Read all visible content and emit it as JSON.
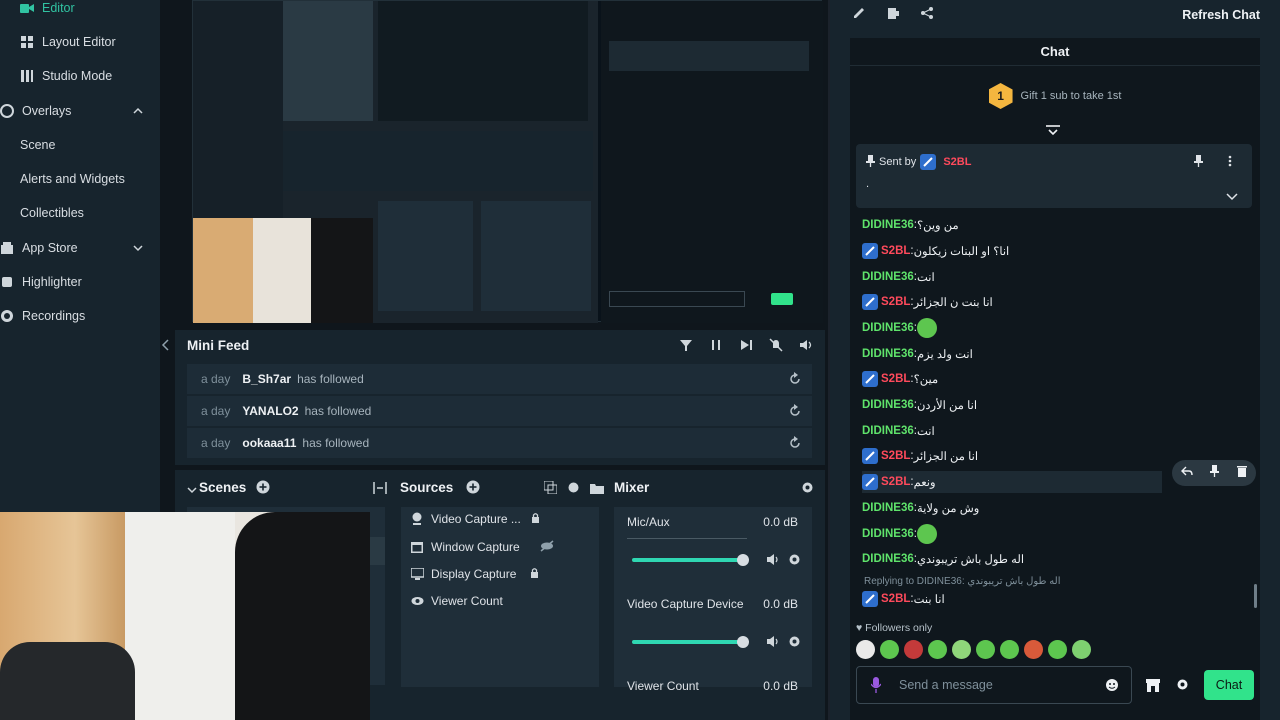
{
  "nav": {
    "items": [
      {
        "label": "Editor",
        "active": true
      },
      {
        "label": "Layout Editor"
      },
      {
        "label": "Studio Mode"
      },
      {
        "label": "Overlays"
      },
      {
        "label": "Scene"
      },
      {
        "label": "Alerts and Widgets"
      },
      {
        "label": "Collectibles"
      },
      {
        "label": "App Store"
      },
      {
        "label": "Highlighter"
      },
      {
        "label": "Recordings"
      }
    ]
  },
  "mini_feed": {
    "title": "Mini Feed",
    "rows": [
      {
        "ago": "a day",
        "name": "B_Sh7ar",
        "action": "has followed"
      },
      {
        "ago": "a day",
        "name": "YANALO2",
        "action": "has followed"
      },
      {
        "ago": "a day",
        "name": "ookaaa11",
        "action": "has followed"
      }
    ]
  },
  "dock": {
    "scenes_title": "Scenes",
    "sources_title": "Sources",
    "mixer_title": "Mixer",
    "sources": [
      "Video Capture ...",
      "Window Capture",
      "Display Capture",
      "Viewer Count"
    ],
    "mixer": [
      {
        "name": "Mic/Aux",
        "db": "0.0 dB"
      },
      {
        "name": "Video Capture Device",
        "db": "0.0 dB"
      },
      {
        "name": "Viewer Count",
        "db": "0.0 dB"
      }
    ]
  },
  "chat": {
    "refresh_label": "Refresh Chat",
    "title": "Chat",
    "gift_text": "Gift 1 sub to take 1st",
    "gift_badge": "1",
    "pinned": {
      "sent_by": "Sent by",
      "user": "S2BL",
      "body": "."
    },
    "messages": [
      {
        "user": "DIDINE36",
        "text": "من وين؟",
        "mod": false
      },
      {
        "user": "S2BL",
        "text": "انا؟ او البنات زيكلون",
        "mod": true
      },
      {
        "user": "DIDINE36",
        "text": "انت",
        "mod": false
      },
      {
        "user": "S2BL",
        "text": "انا بنت ن الجزائر",
        "mod": true
      },
      {
        "user": "DIDINE36",
        "text": "",
        "mod": false,
        "emote": true
      },
      {
        "user": "DIDINE36",
        "text": "انت ولد يزم",
        "mod": false
      },
      {
        "user": "S2BL",
        "text": "مين؟",
        "mod": true
      },
      {
        "user": "DIDINE36",
        "text": "انا من الأردن",
        "mod": false
      },
      {
        "user": "DIDINE36",
        "text": "انت",
        "mod": false
      },
      {
        "user": "S2BL",
        "text": "انا من الجزائر",
        "mod": true
      },
      {
        "user": "S2BL",
        "text": "ونعم",
        "mod": true
      },
      {
        "user": "DIDINE36",
        "text": "وش من ولاية",
        "mod": false
      },
      {
        "user": "DIDINE36",
        "text": "",
        "mod": false,
        "emote": true
      },
      {
        "user": "DIDINE36",
        "text": "اله طول باش تريبوندي",
        "mod": false
      },
      {
        "user": "S2BL",
        "text": "انا بنت",
        "mod": true
      }
    ],
    "reply_context": "Replying to DIDINE36: اله طول باش تريبوندي",
    "followers_only": "Followers only",
    "input_placeholder": "Send a message",
    "send_label": "Chat"
  },
  "colors": {
    "accent": "#31c3a2",
    "didine": "#5fe36b",
    "s2bl": "#ff4a5c",
    "chat_button": "#31e38b"
  }
}
